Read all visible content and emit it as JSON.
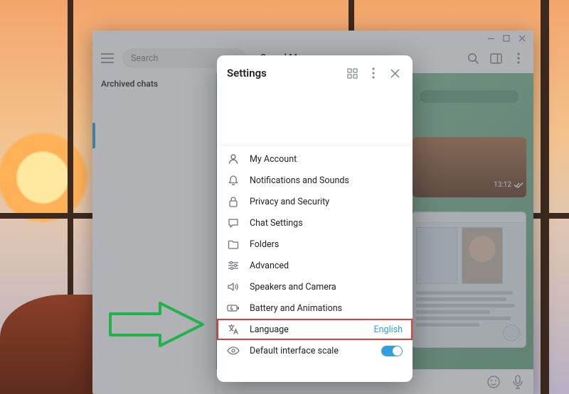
{
  "window": {
    "title": "",
    "controls": {
      "minimize": "–",
      "maximize": "▢",
      "close": "✕"
    }
  },
  "toolbar": {
    "search_placeholder": "Search",
    "chat_title": "Saved Messages"
  },
  "sidebar": {
    "archived_label": "Archived chats"
  },
  "chat": {
    "time_badge": "13:12"
  },
  "settings": {
    "title": "Settings",
    "items": [
      {
        "label": "My Account",
        "icon": "account-icon"
      },
      {
        "label": "Notifications and Sounds",
        "icon": "bell-icon"
      },
      {
        "label": "Privacy and Security",
        "icon": "lock-icon"
      },
      {
        "label": "Chat Settings",
        "icon": "chat-icon"
      },
      {
        "label": "Folders",
        "icon": "folder-icon"
      },
      {
        "label": "Advanced",
        "icon": "sliders-icon"
      },
      {
        "label": "Speakers and Camera",
        "icon": "speaker-icon"
      },
      {
        "label": "Battery and Animations",
        "icon": "battery-icon"
      },
      {
        "label": "Language",
        "icon": "language-icon",
        "value": "English",
        "highlight": true
      },
      {
        "label": "Default interface scale",
        "icon": "eye-icon",
        "toggle": true
      }
    ]
  },
  "colors": {
    "accent": "#2f9fe0",
    "highlight_border": "#e43a3a",
    "arrow": "#22b24c"
  }
}
